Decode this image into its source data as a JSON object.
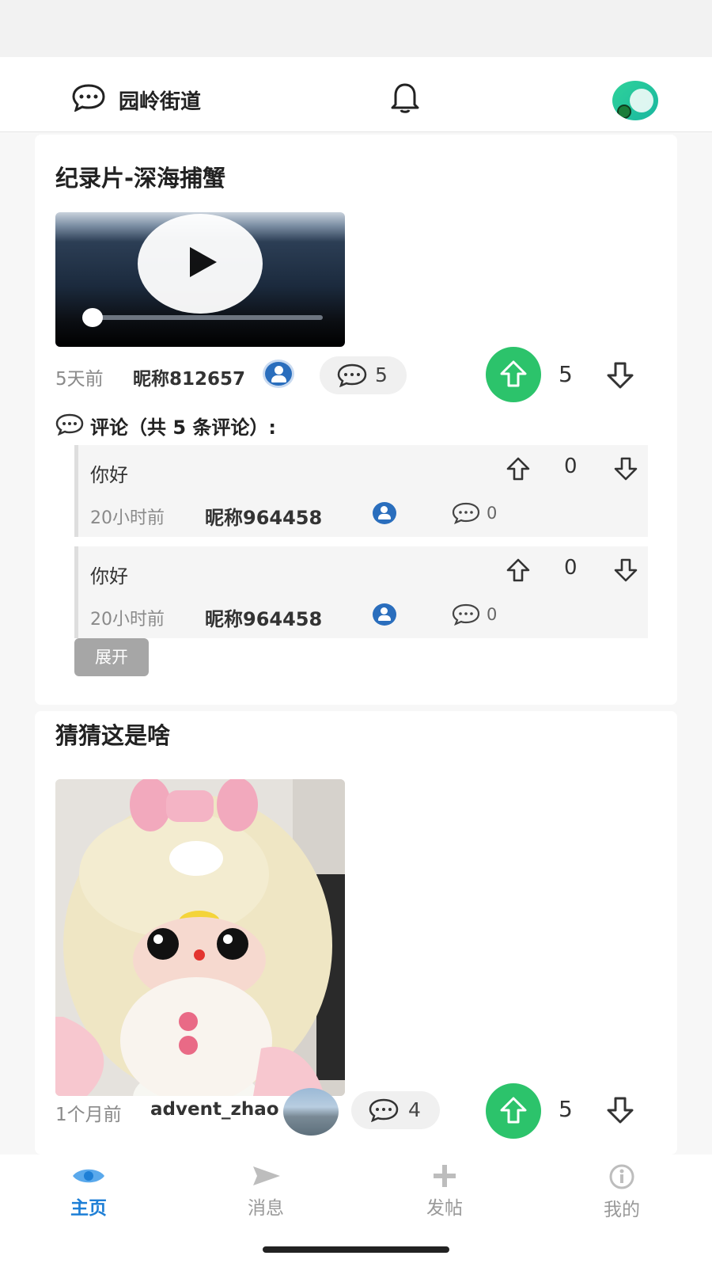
{
  "header": {
    "title": "园岭街道"
  },
  "posts": [
    {
      "title": "纪录片-深海捕蟹",
      "time": "5天前",
      "user": "昵称812657",
      "comment_count": "5",
      "votes": "5",
      "comments_header": "评论（共 5 条评论）:",
      "comments": [
        {
          "text": "你好",
          "time": "20小时前",
          "user": "昵称964458",
          "replies": "0",
          "votes": "0"
        },
        {
          "text": "你好",
          "time": "20小时前",
          "user": "昵称964458",
          "replies": "0",
          "votes": "0"
        }
      ],
      "expand_label": "展开"
    },
    {
      "title": "猜猜这是啥",
      "time": "1个月前",
      "user": "advent_zhao",
      "comment_count": "4",
      "votes": "5"
    }
  ],
  "nav": [
    {
      "label": "主页",
      "icon": "eye-icon",
      "active": true
    },
    {
      "label": "消息",
      "icon": "send-icon",
      "active": false
    },
    {
      "label": "发帖",
      "icon": "plus-icon",
      "active": false
    },
    {
      "label": "我的",
      "icon": "info-icon",
      "active": false
    }
  ],
  "colors": {
    "accent": "#1e7fd6",
    "upvote": "#2cc36b",
    "badge": "#2a6ebd"
  }
}
